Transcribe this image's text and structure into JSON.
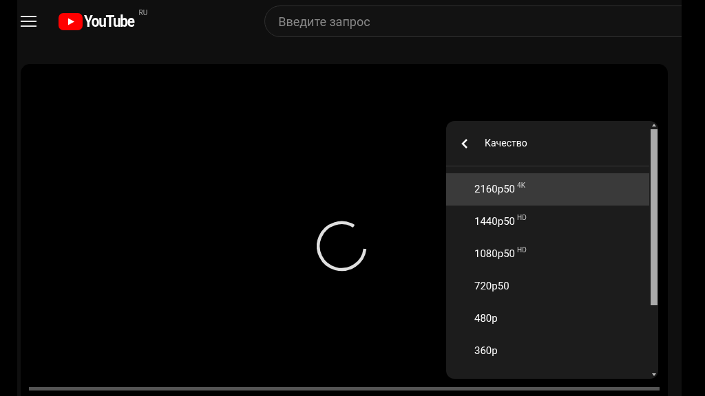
{
  "header": {
    "logo": "YouTube",
    "region": "RU",
    "search": {
      "placeholder": "Введите запрос"
    }
  },
  "quality_menu": {
    "title": "Качество",
    "items": [
      {
        "label": "2160p50",
        "badge": "4K",
        "selected": true
      },
      {
        "label": "1440p50",
        "badge": "HD",
        "selected": false
      },
      {
        "label": "1080p50",
        "badge": "HD",
        "selected": false
      },
      {
        "label": "720p50",
        "selected": false
      },
      {
        "label": "480p",
        "selected": false
      },
      {
        "label": "360p",
        "selected": false
      }
    ]
  }
}
